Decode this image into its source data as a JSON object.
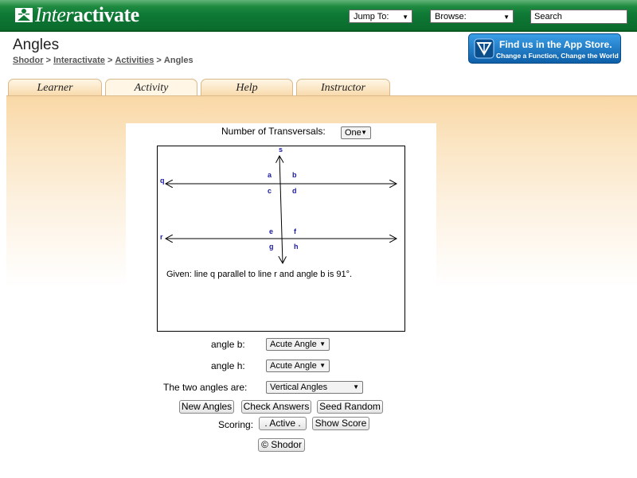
{
  "header": {
    "logo_text_light": "Inter",
    "logo_text_bold": "activate",
    "jump_to": "Jump To:",
    "browse": "Browse:",
    "search_placeholder": "Search"
  },
  "page": {
    "title": "Angles",
    "breadcrumb": [
      "Shodor",
      "Interactivate",
      "Activities",
      "Angles"
    ],
    "breadcrumb_sep": ">"
  },
  "appstore": {
    "line1": "Find us in the App Store.",
    "line2": "Change a Function, Change the World"
  },
  "tabs": [
    {
      "label": "Learner",
      "active": false
    },
    {
      "label": "Activity",
      "active": true
    },
    {
      "label": "Help",
      "active": false
    },
    {
      "label": "Instructor",
      "active": false
    }
  ],
  "applet": {
    "transversals_label": "Number of Transversals:",
    "transversals_value": "One",
    "diagram": {
      "lines": [
        "q",
        "r",
        "s"
      ],
      "angle_labels": [
        "a",
        "b",
        "c",
        "d",
        "e",
        "f",
        "g",
        "h"
      ],
      "given": "Given: line q parallel to line r and angle b is 91°."
    },
    "angle_b_label": "angle b:",
    "angle_b_value": "Acute Angle",
    "angle_h_label": "angle h:",
    "angle_h_value": "Acute Angle",
    "relation_label": "The two angles are:",
    "relation_value": "Vertical Angles",
    "buttons": {
      "new_angles": "New Angles",
      "check_answers": "Check Answers",
      "seed_random": "Seed Random",
      "active": ". Active .",
      "show_score": "Show Score",
      "shodor": "© Shodor"
    },
    "scoring_label": "Scoring:"
  },
  "colors": {
    "topbar": "#0f7a36",
    "tab_fill": "#f8d9a9",
    "appstore": "#1a74c4",
    "angle_label": "#1a1aa0"
  }
}
